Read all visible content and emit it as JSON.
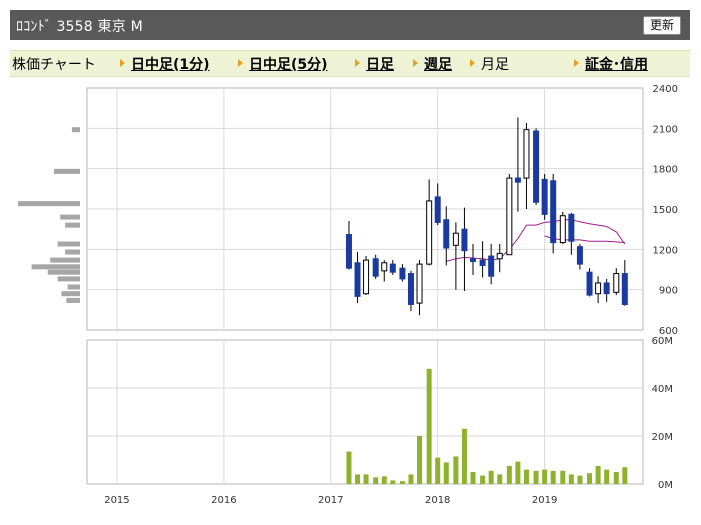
{
  "header": {
    "title": "ﾛｺﾝﾄﾞ 3558  東京 M",
    "refresh_label": "更新"
  },
  "tabs": [
    {
      "label": "株価チャート",
      "link": false,
      "arrow": false
    },
    {
      "label": "日中足(1分)",
      "link": true,
      "arrow": true
    },
    {
      "label": "日中足(5分)",
      "link": true,
      "arrow": true
    },
    {
      "label": "日足",
      "link": true,
      "arrow": true
    },
    {
      "label": "週足",
      "link": true,
      "arrow": true
    },
    {
      "label": "月足",
      "link": false,
      "arrow": true
    },
    {
      "label": "証金･信用",
      "link": true,
      "arrow": true
    }
  ],
  "colors": {
    "candle_down": "#1a3aa0",
    "candle_up_fill": "#ffffff",
    "ma_line": "#a01c8c",
    "volume_bar": "#8fb22e",
    "vp_bar": "#a6a6a6",
    "grid": "#d9d9d9"
  },
  "chart_data": [
    {
      "type": "candlestick",
      "x_unit": "year",
      "xlim": [
        2014.72,
        2019.92
      ],
      "ylim": [
        600,
        2400
      ],
      "y_ticks": [
        "600",
        "900",
        "1200",
        "1500",
        "1800",
        "2100",
        "2400"
      ],
      "candles": [
        {
          "t": 2017.17,
          "o": 1310,
          "h": 1410,
          "l": 1050,
          "c": 1060
        },
        {
          "t": 2017.25,
          "o": 1100,
          "h": 1180,
          "l": 800,
          "c": 850
        },
        {
          "t": 2017.33,
          "o": 870,
          "h": 1150,
          "l": 860,
          "c": 1120
        },
        {
          "t": 2017.42,
          "o": 1130,
          "h": 1160,
          "l": 980,
          "c": 1000
        },
        {
          "t": 2017.5,
          "o": 1040,
          "h": 1120,
          "l": 960,
          "c": 1100
        },
        {
          "t": 2017.58,
          "o": 1090,
          "h": 1120,
          "l": 1010,
          "c": 1030
        },
        {
          "t": 2017.67,
          "o": 1060,
          "h": 1090,
          "l": 960,
          "c": 980
        },
        {
          "t": 2017.75,
          "o": 1020,
          "h": 1040,
          "l": 740,
          "c": 790
        },
        {
          "t": 2017.83,
          "o": 800,
          "h": 1120,
          "l": 710,
          "c": 1090
        },
        {
          "t": 2017.92,
          "o": 1090,
          "h": 1720,
          "l": 1080,
          "c": 1560
        },
        {
          "t": 2018.0,
          "o": 1590,
          "h": 1690,
          "l": 1380,
          "c": 1400
        },
        {
          "t": 2018.08,
          "o": 1420,
          "h": 1520,
          "l": 1080,
          "c": 1210
        },
        {
          "t": 2018.17,
          "o": 1230,
          "h": 1400,
          "l": 900,
          "c": 1320
        },
        {
          "t": 2018.25,
          "o": 1350,
          "h": 1510,
          "l": 890,
          "c": 1190
        },
        {
          "t": 2018.33,
          "o": 1130,
          "h": 1240,
          "l": 1010,
          "c": 1110
        },
        {
          "t": 2018.42,
          "o": 1120,
          "h": 1260,
          "l": 990,
          "c": 1080
        },
        {
          "t": 2018.5,
          "o": 1150,
          "h": 1240,
          "l": 940,
          "c": 1000
        },
        {
          "t": 2018.58,
          "o": 1130,
          "h": 1240,
          "l": 1030,
          "c": 1170
        },
        {
          "t": 2018.67,
          "o": 1160,
          "h": 1760,
          "l": 1160,
          "c": 1730
        },
        {
          "t": 2018.75,
          "o": 1730,
          "h": 2180,
          "l": 1480,
          "c": 1700
        },
        {
          "t": 2018.83,
          "o": 1730,
          "h": 2140,
          "l": 1500,
          "c": 2090
        },
        {
          "t": 2018.92,
          "o": 2080,
          "h": 2100,
          "l": 1530,
          "c": 1550
        },
        {
          "t": 2019.0,
          "o": 1720,
          "h": 1760,
          "l": 1420,
          "c": 1460
        },
        {
          "t": 2019.08,
          "o": 1710,
          "h": 1760,
          "l": 1170,
          "c": 1250
        },
        {
          "t": 2019.17,
          "o": 1250,
          "h": 1480,
          "l": 1240,
          "c": 1450
        },
        {
          "t": 2019.25,
          "o": 1460,
          "h": 1470,
          "l": 1160,
          "c": 1260
        },
        {
          "t": 2019.33,
          "o": 1220,
          "h": 1240,
          "l": 1050,
          "c": 1090
        },
        {
          "t": 2019.42,
          "o": 1030,
          "h": 1060,
          "l": 850,
          "c": 860
        },
        {
          "t": 2019.5,
          "o": 870,
          "h": 1000,
          "l": 800,
          "c": 950
        },
        {
          "t": 2019.58,
          "o": 950,
          "h": 980,
          "l": 810,
          "c": 870
        },
        {
          "t": 2019.67,
          "o": 880,
          "h": 1060,
          "l": 860,
          "c": 1020
        },
        {
          "t": 2019.75,
          "o": 1020,
          "h": 1120,
          "l": 780,
          "c": 790
        }
      ],
      "moving_averages": [
        {
          "points": [
            [
              2018.08,
              1110
            ],
            [
              2018.17,
              1130
            ],
            [
              2018.25,
              1140
            ],
            [
              2018.33,
              1135
            ],
            [
              2018.42,
              1130
            ],
            [
              2018.5,
              1120
            ],
            [
              2018.58,
              1130
            ],
            [
              2018.67,
              1200
            ],
            [
              2018.75,
              1280
            ],
            [
              2018.83,
              1380
            ],
            [
              2018.92,
              1380
            ],
            [
              2019.0,
              1400
            ],
            [
              2019.08,
              1405
            ],
            [
              2019.17,
              1420
            ],
            [
              2019.25,
              1420
            ],
            [
              2019.33,
              1405
            ],
            [
              2019.42,
              1390
            ],
            [
              2019.5,
              1380
            ],
            [
              2019.58,
              1370
            ],
            [
              2019.67,
              1330
            ],
            [
              2019.75,
              1240
            ]
          ]
        },
        {
          "points": [
            [
              2019.0,
              1300
            ],
            [
              2019.08,
              1280
            ],
            [
              2019.17,
              1270
            ],
            [
              2019.25,
              1270
            ],
            [
              2019.33,
              1270
            ],
            [
              2019.42,
              1260
            ],
            [
              2019.5,
              1260
            ],
            [
              2019.58,
              1260
            ],
            [
              2019.67,
              1255
            ],
            [
              2019.75,
              1250
            ]
          ]
        }
      ],
      "volume_profile": [
        {
          "price": 2090,
          "rel": 0.13
        },
        {
          "price": 1780,
          "rel": 0.42
        },
        {
          "price": 1540,
          "rel": 1.0
        },
        {
          "price": 1440,
          "rel": 0.32
        },
        {
          "price": 1380,
          "rel": 0.24
        },
        {
          "price": 1240,
          "rel": 0.36
        },
        {
          "price": 1180,
          "rel": 0.24
        },
        {
          "price": 1120,
          "rel": 0.48
        },
        {
          "price": 1070,
          "rel": 0.78
        },
        {
          "price": 1030,
          "rel": 0.52
        },
        {
          "price": 980,
          "rel": 0.36
        },
        {
          "price": 920,
          "rel": 0.2
        },
        {
          "price": 870,
          "rel": 0.3
        },
        {
          "price": 820,
          "rel": 0.22
        }
      ]
    },
    {
      "type": "bar",
      "x_unit": "year",
      "xlim": [
        2014.72,
        2019.92
      ],
      "ylim": [
        0,
        60
      ],
      "y_ticks": [
        "0M",
        "20M",
        "40M",
        "60M"
      ],
      "x_ticks": [
        "2015",
        "2016",
        "2017",
        "2018",
        "2019"
      ],
      "bars": [
        {
          "t": 2017.17,
          "v": 13.5
        },
        {
          "t": 2017.25,
          "v": 4
        },
        {
          "t": 2017.33,
          "v": 4
        },
        {
          "t": 2017.42,
          "v": 2.8
        },
        {
          "t": 2017.5,
          "v": 3.2
        },
        {
          "t": 2017.58,
          "v": 1.5
        },
        {
          "t": 2017.67,
          "v": 1.2
        },
        {
          "t": 2017.75,
          "v": 4
        },
        {
          "t": 2017.83,
          "v": 20
        },
        {
          "t": 2017.92,
          "v": 48
        },
        {
          "t": 2018.0,
          "v": 11
        },
        {
          "t": 2018.08,
          "v": 9
        },
        {
          "t": 2018.17,
          "v": 11.5
        },
        {
          "t": 2018.25,
          "v": 23
        },
        {
          "t": 2018.33,
          "v": 5
        },
        {
          "t": 2018.42,
          "v": 3.5
        },
        {
          "t": 2018.5,
          "v": 5.5
        },
        {
          "t": 2018.58,
          "v": 4
        },
        {
          "t": 2018.67,
          "v": 7.5
        },
        {
          "t": 2018.75,
          "v": 9.3
        },
        {
          "t": 2018.83,
          "v": 6
        },
        {
          "t": 2018.92,
          "v": 5.5
        },
        {
          "t": 2019.0,
          "v": 6
        },
        {
          "t": 2019.08,
          "v": 5.5
        },
        {
          "t": 2019.17,
          "v": 5.5
        },
        {
          "t": 2019.25,
          "v": 4
        },
        {
          "t": 2019.33,
          "v": 3.5
        },
        {
          "t": 2019.42,
          "v": 4.5
        },
        {
          "t": 2019.5,
          "v": 7.5
        },
        {
          "t": 2019.58,
          "v": 6
        },
        {
          "t": 2019.67,
          "v": 5
        },
        {
          "t": 2019.75,
          "v": 7
        }
      ]
    }
  ]
}
